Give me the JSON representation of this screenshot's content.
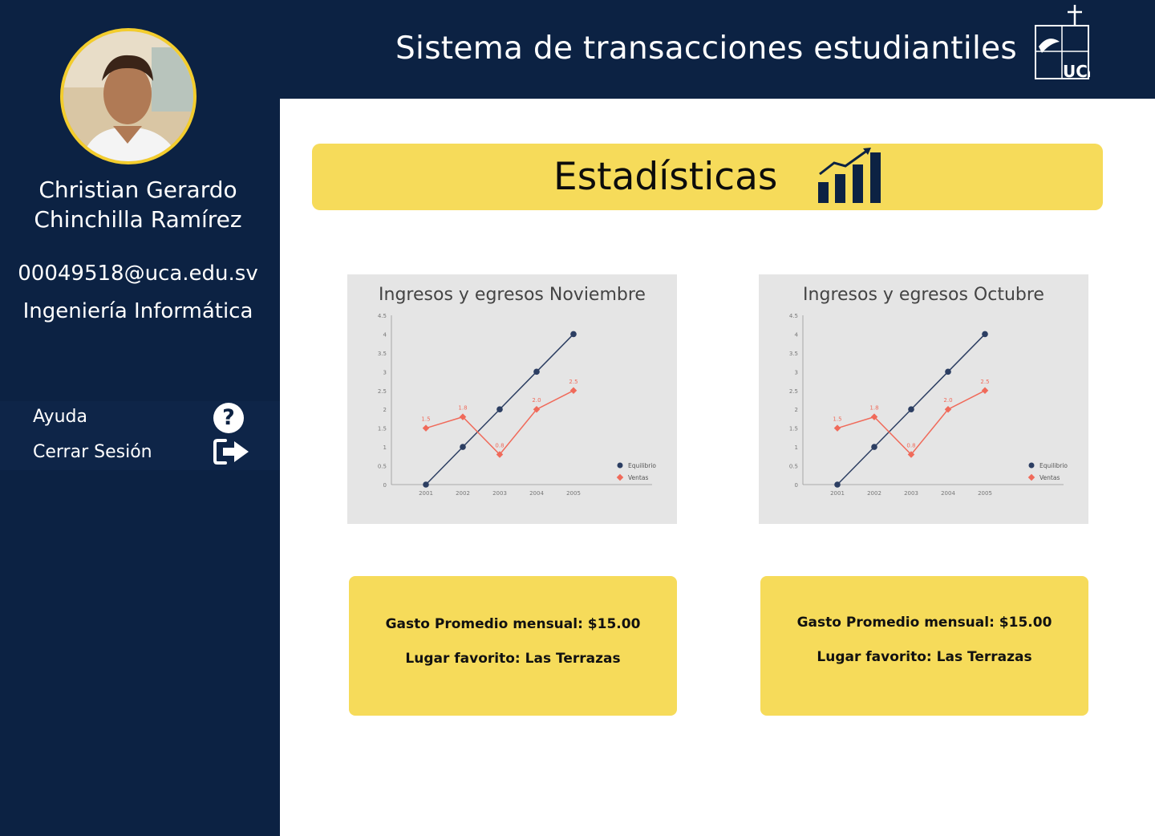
{
  "header": {
    "title": "Sistema de transacciones estudiantiles",
    "logo_text": "UCA"
  },
  "sidebar": {
    "name_line1": "Christian Gerardo",
    "name_line2": "Chinchilla Ramírez",
    "email": "00049518@uca.edu.sv",
    "career": "Ingeniería Informática",
    "menu": {
      "help_label": "Ayuda",
      "logout_label": "Cerrar Sesión"
    }
  },
  "main": {
    "stats_title": "Estadísticas",
    "cards": [
      {
        "expense": "Gasto Promedio mensual: $15.00",
        "place": "Lugar favorito: Las Terrazas"
      },
      {
        "expense": "Gasto Promedio mensual: $15.00",
        "place": "Lugar favorito: Las Terrazas"
      }
    ]
  },
  "colors": {
    "navy": "#0c2243",
    "yellow": "#f6db5a",
    "avatar_border": "#f3cd2d",
    "series_equilibrio": "#2c3e62",
    "series_ventas": "#f06a5a"
  },
  "chart_data": [
    {
      "type": "line",
      "title": "Ingresos y egresos Noviembre",
      "x": [
        "2001",
        "2002",
        "2003",
        "2004",
        "2005"
      ],
      "ylim": [
        0,
        4.5
      ],
      "yticks": [
        "0",
        "0.5",
        "1",
        "1.5",
        "2",
        "2.5",
        "3",
        "3.5",
        "4",
        "4.5"
      ],
      "legend": "right",
      "series": [
        {
          "name": "Equilibrio",
          "values": [
            0,
            1,
            2,
            3,
            4
          ],
          "color": "#2c3e62"
        },
        {
          "name": "Ventas",
          "values": [
            1.5,
            1.8,
            0.8,
            2.0,
            2.5
          ],
          "labels": [
            "1.5",
            "1.8",
            "0.8",
            "2.0",
            "2.5"
          ],
          "color": "#f06a5a"
        }
      ]
    },
    {
      "type": "line",
      "title": "Ingresos y egresos Octubre",
      "x": [
        "2001",
        "2002",
        "2003",
        "2004",
        "2005"
      ],
      "ylim": [
        0,
        4.5
      ],
      "yticks": [
        "0",
        "0.5",
        "1",
        "1.5",
        "2",
        "2.5",
        "3",
        "3.5",
        "4",
        "4.5"
      ],
      "legend": "right",
      "series": [
        {
          "name": "Equilibrio",
          "values": [
            0,
            1,
            2,
            3,
            4
          ],
          "color": "#2c3e62"
        },
        {
          "name": "Ventas",
          "values": [
            1.5,
            1.8,
            0.8,
            2.0,
            2.5
          ],
          "labels": [
            "1.5",
            "1.8",
            "0.8",
            "2.0",
            "2.5"
          ],
          "color": "#f06a5a"
        }
      ]
    }
  ]
}
